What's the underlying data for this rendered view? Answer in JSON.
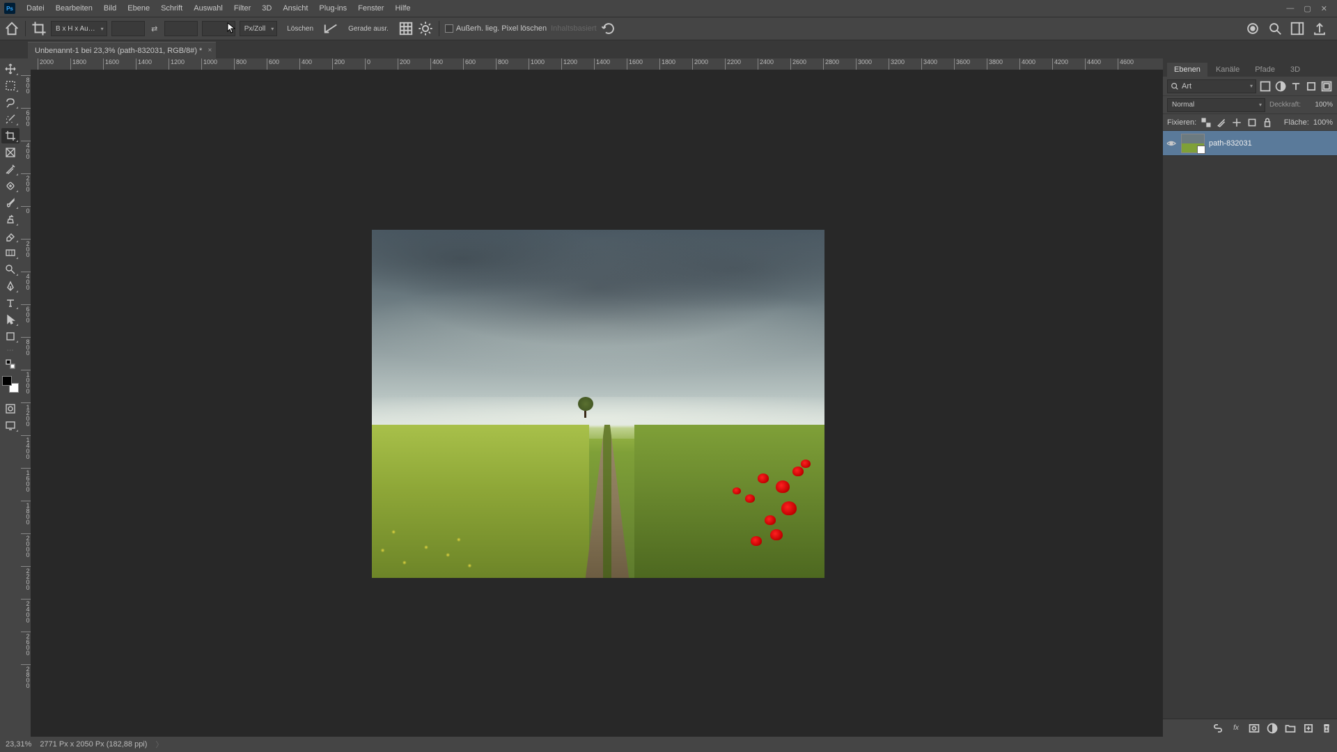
{
  "menubar": {
    "items": [
      "Datei",
      "Bearbeiten",
      "Bild",
      "Ebene",
      "Schrift",
      "Auswahl",
      "Filter",
      "3D",
      "Ansicht",
      "Plug-ins",
      "Fenster",
      "Hilfe"
    ]
  },
  "optionsbar": {
    "ratio_preset": "B x H x Au…",
    "width": "",
    "height": "",
    "resolution": "",
    "res_unit": "Px/Zoll",
    "clear": "Löschen",
    "straighten": "Gerade ausr.",
    "delete_cropped": "Außerh. lieg. Pixel löschen",
    "content_aware": "Inhaltsbasiert"
  },
  "doctab": {
    "title": "Unbenannt-1 bei 23,3% (path-832031, RGB/8#) *"
  },
  "ruler_h": [
    "2000",
    "1800",
    "1600",
    "1400",
    "1200",
    "1000",
    "800",
    "600",
    "400",
    "200",
    "0",
    "200",
    "400",
    "600",
    "800",
    "1000",
    "1200",
    "1400",
    "1600",
    "1800",
    "2000",
    "2200",
    "2400",
    "2600",
    "2800",
    "3000",
    "3200",
    "3400",
    "3600",
    "3800",
    "4000",
    "4200",
    "4400",
    "4600"
  ],
  "ruler_v": [
    "800",
    "600",
    "400",
    "200",
    "0",
    "200",
    "400",
    "600",
    "800",
    "1000",
    "1200",
    "1400",
    "1600",
    "1800",
    "2000",
    "2200",
    "2400",
    "2600",
    "2800"
  ],
  "panels": {
    "tabs": [
      "Ebenen",
      "Kanäle",
      "Pfade",
      "3D"
    ],
    "search_placeholder": "Art",
    "blend_mode": "Normal",
    "opacity_label": "Deckkraft:",
    "opacity_value": "100%",
    "lock_label": "Fixieren:",
    "fill_label": "Fläche:",
    "fill_value": "100%",
    "layer_name": "path-832031"
  },
  "statusbar": {
    "zoom": "23,31%",
    "doc_info": "2771 Px x 2050 Px (182,88 ppi)"
  }
}
